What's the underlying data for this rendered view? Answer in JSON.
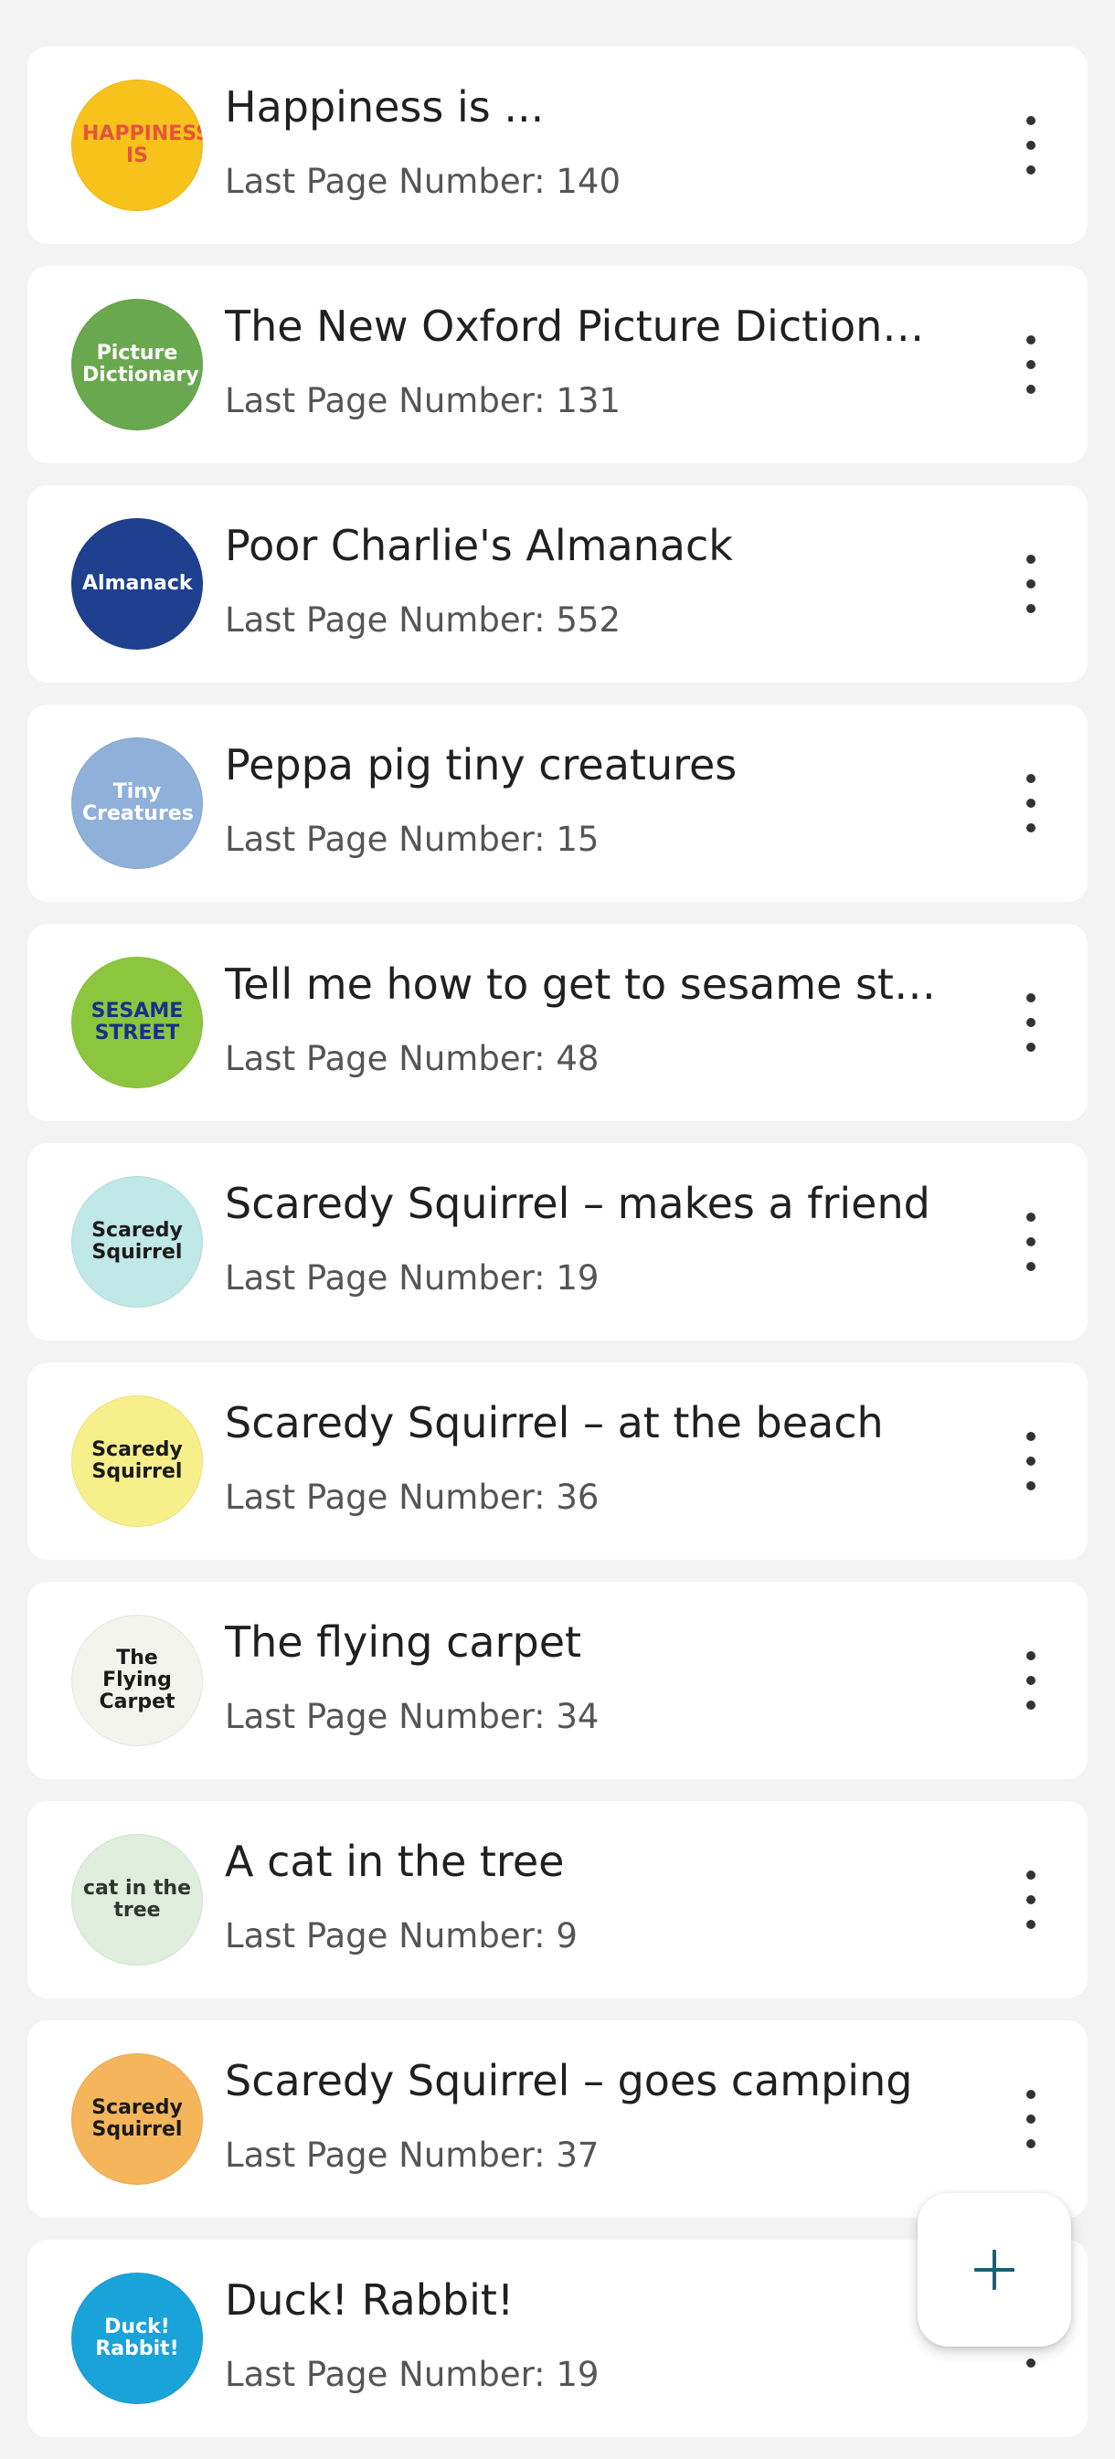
{
  "books": [
    {
      "title": "Happiness is ...",
      "subtitle": "Last Page Number: 140",
      "cover_text": "HAPPINESS IS",
      "cover_bg": "#f7c21b",
      "cover_fg": "#e5533d",
      "icon": "book-cover-image"
    },
    {
      "title": "The New Oxford Picture Diction…",
      "subtitle": "Last Page Number: 131",
      "cover_text": "Picture Dictionary",
      "cover_bg": "#6aa84f",
      "cover_fg": "#ffffff",
      "icon": "book-cover-image"
    },
    {
      "title": "Poor Charlie's Almanack",
      "subtitle": "Last Page Number: 552",
      "cover_text": "Almanack",
      "cover_bg": "#1f3f8f",
      "cover_fg": "#ffffff",
      "icon": "book-cover-image"
    },
    {
      "title": "Peppa pig tiny creatures",
      "subtitle": "Last Page Number: 15",
      "cover_text": "Tiny Creatures",
      "cover_bg": "#8fb0d8",
      "cover_fg": "#ffffff",
      "icon": "book-cover-image"
    },
    {
      "title": "Tell me how to get to sesame st…",
      "subtitle": "Last Page Number: 48",
      "cover_text": "SESAME STREET",
      "cover_bg": "#8cc63f",
      "cover_fg": "#1a2f8a",
      "icon": "book-cover-image"
    },
    {
      "title": "Scaredy Squirrel – makes a friend",
      "subtitle": "Last Page Number: 19",
      "cover_text": "Scaredy Squirrel",
      "cover_bg": "#bfe8e6",
      "cover_fg": "#1a1a1a",
      "icon": "book-cover-image"
    },
    {
      "title": "Scaredy Squirrel – at the beach",
      "subtitle": "Last Page Number: 36",
      "cover_text": "Scaredy Squirrel",
      "cover_bg": "#f7ef8a",
      "cover_fg": "#1a1a1a",
      "icon": "book-cover-image"
    },
    {
      "title": "The flying carpet",
      "subtitle": "Last Page Number: 34",
      "cover_text": "The Flying Carpet",
      "cover_bg": "#f4f4ee",
      "cover_fg": "#1a1a1a",
      "icon": "book-cover-image"
    },
    {
      "title": "A cat in the tree",
      "subtitle": "Last Page Number: 9",
      "cover_text": "cat in the tree",
      "cover_bg": "#dfeedd",
      "cover_fg": "#333333",
      "icon": "book-cover-image"
    },
    {
      "title": "Scaredy Squirrel – goes camping",
      "subtitle": "Last Page Number: 37",
      "cover_text": "Scaredy Squirrel",
      "cover_bg": "#f5b55a",
      "cover_fg": "#1a1a1a",
      "icon": "book-cover-image"
    },
    {
      "title": "Duck! Rabbit!",
      "subtitle": "Last Page Number: 19",
      "cover_text": "Duck! Rabbit!",
      "cover_bg": "#1aa3d8",
      "cover_fg": "#ffffff",
      "icon": "book-cover-image"
    }
  ],
  "menu_icon": "more-vertical-icon",
  "fab": {
    "icon": "plus-icon",
    "color": "#1e5f73"
  }
}
